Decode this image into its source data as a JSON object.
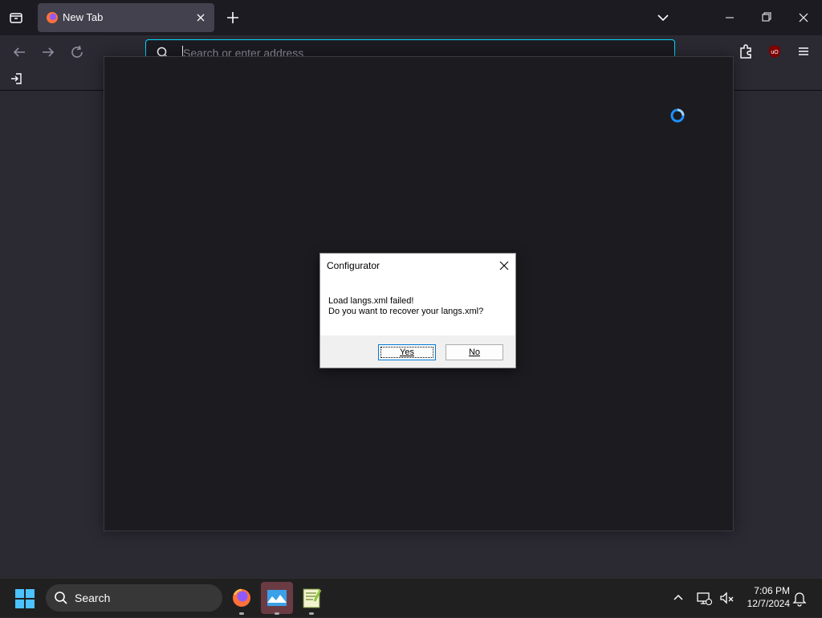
{
  "browser": {
    "tab": {
      "title": "New Tab"
    },
    "urlbar": {
      "placeholder": "Search or enter address"
    }
  },
  "dialog": {
    "title": "Configurator",
    "message_line1": "Load langs.xml failed!",
    "message_line2": "Do you want to recover your langs.xml?",
    "yes_label": "Yes",
    "no_label": "No"
  },
  "taskbar": {
    "search_label": "Search",
    "apps": [
      "firefox-icon",
      "configurator-icon",
      "notepad-plus-plus-icon"
    ],
    "time": "7:06 PM",
    "date": "12/7/2024"
  },
  "colors": {
    "accent": "#00ddff",
    "spinner": "#1e90ff",
    "active_app": "#6b3b44"
  },
  "icons": [
    "tab-list-icon",
    "firefox-favicon-icon",
    "close-icon",
    "plus-icon",
    "chevron-down-icon",
    "minimize-icon",
    "restore-icon",
    "back-arrow-icon",
    "forward-arrow-icon",
    "reload-icon",
    "search-icon",
    "extensions-icon",
    "ublock-icon",
    "hamburger-menu-icon",
    "import-icon",
    "loading-spinner-icon",
    "windows-start-icon",
    "network-icon",
    "volume-muted-icon",
    "bell-icon"
  ]
}
